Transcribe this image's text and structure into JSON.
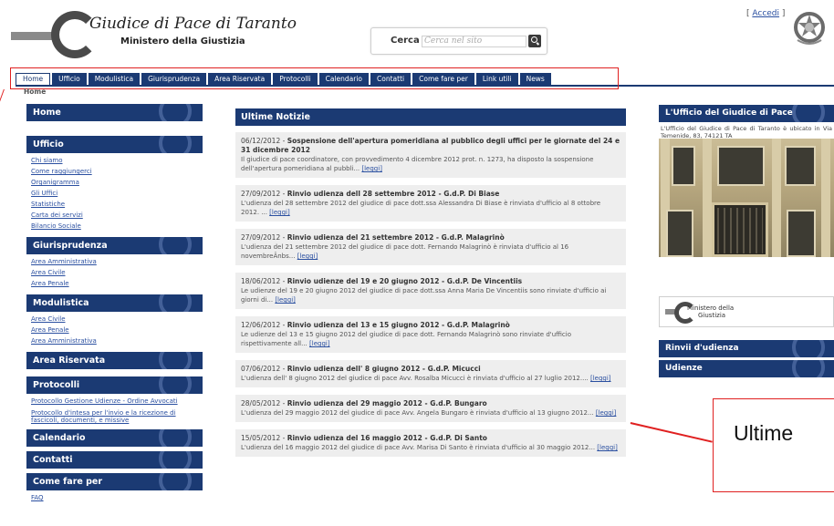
{
  "header": {
    "logo_title": "Giudice di Pace di Taranto",
    "logo_subtitle": "Ministero della Giustizia",
    "search_label": "Cerca",
    "search_placeholder": "Cerca nel sito",
    "login_open": "[ ",
    "login_label": "Accedi",
    "login_close": " ]"
  },
  "nav": {
    "items": [
      "Home",
      "Ufficio",
      "Modulistica",
      "Giurisprudenza",
      "Area Riservata",
      "Protocolli",
      "Calendario",
      "Contatti",
      "Come fare per",
      "Link utili",
      "News"
    ],
    "active": "Home"
  },
  "breadcrumb": "Home",
  "left": {
    "home": "Home",
    "ufficio": {
      "title": "Ufficio",
      "links": [
        "Chi siamo",
        "Come raggiungerci",
        "Organigramma",
        "Gli Uffici",
        "Statistiche",
        "Carta dei servizi",
        "Bilancio Sociale"
      ]
    },
    "giurisprudenza": {
      "title": "Giurisprudenza",
      "links": [
        "Area Amministrativa",
        "Area Civile",
        "Area Penale"
      ]
    },
    "modulistica": {
      "title": "Modulistica",
      "links": [
        "Area Civile",
        "Area Penale",
        "Area Amministrativa"
      ]
    },
    "area_riservata": "Area Riservata",
    "protocolli": {
      "title": "Protocolli",
      "links": [
        "Protocollo Gestione Udienze - Ordine Avvocati",
        "Protocollo d'intesa per l'invio e la ricezione di fascicoli, documenti, e missive"
      ]
    },
    "calendario": "Calendario",
    "contatti": "Contatti",
    "come_fare_per": {
      "title": "Come fare per",
      "links": [
        "FAQ"
      ]
    }
  },
  "center": {
    "title": "Ultime Notizie",
    "news": [
      {
        "date": "06/12/2012 - ",
        "title": "Sospensione dell'apertura pomeridiana al pubblico degli uffici per le giornate del 24 e 31 dicembre 2012",
        "body": "Il giudice di pace coordinatore, con provvedimento 4 dicembre 2012 prot. n. 1273, ha disposto la sospensione dell'apertura pomeridiana al pubbli... ",
        "link": "[leggi]"
      },
      {
        "date": "27/09/2012 - ",
        "title": "Rinvio udienza dell 28 settembre 2012 - G.d.P. Di Biase",
        "body": "L'udienza del 28 settembre 2012 del giudice di pace dott.ssa Alessandra Di Biase è rinviata d'ufficio al 8 ottobre 2012. ... ",
        "link": "[leggi]"
      },
      {
        "date": "27/09/2012 - ",
        "title": "Rinvio udienza del 21 settembre 2012 - G.d.P. Malagrinò",
        "body": "L'udienza del 21 settembre 2012 del giudice di pace dott. Fernando Malagrinò è rinviata d'ufficio al 16 novembreÂnbs... ",
        "link": "[leggi]"
      },
      {
        "date": "18/06/2012 - ",
        "title": "Rinvio udienze del 19 e 20 giugno 2012 - G.d.P. De Vincentiis",
        "body": "Le udienze del 19 e 20 giugno 2012 del giudice di pace dott.ssa Anna Maria De Vincentiis sono rinviate d'ufficio ai giorni di... ",
        "link": "[leggi]"
      },
      {
        "date": "12/06/2012 - ",
        "title": "Rinvio udienza del 13 e 15 giugno 2012 - G.d.P. Malagrinò",
        "body": "Le udienze del 13 e 15 giugno 2012 del giudice di pace dott. Fernando Malagrinò sono rinviate d'ufficio rispettivamente all... ",
        "link": "[leggi]"
      },
      {
        "date": "07/06/2012 - ",
        "title": "Rinvio udienza dell' 8 giugno 2012 - G.d.P. Micucci",
        "body": "L'udienza dell' 8 giugno 2012 del giudice di pace Avv. Rosalba Micucci è rinviata d'ufficio al 27 luglio 2012.... ",
        "link": "[leggi]"
      },
      {
        "date": "28/05/2012 - ",
        "title": "Rinvio udienza del 29 maggio 2012 - G.d.P. Bungaro",
        "body": "L'udienza del 29 maggio 2012 del giudice di pace Avv. Angela Bungaro è rinviata d'ufficio al 13 giugno 2012... ",
        "link": "[leggi]"
      },
      {
        "date": "15/05/2012 - ",
        "title": "Rinvio udienza del 16 maggio 2012 - G.d.P. Di Santo",
        "body": "L'udienza del 16 maggio 2012 del giudice di pace Avv. Marisa Di Santo è rinviata d'ufficio al 30 maggio 2012... ",
        "link": "[leggi]"
      }
    ]
  },
  "right": {
    "office_title": "L'Ufficio del Giudice di Pace",
    "office_text": "L'Ufficio del Giudice di Pace di Taranto è ubicato in Via Temenide, 83, 74121 TA",
    "ministry_line1": "Ministero della",
    "ministry_line2": "Giustizia",
    "rinvii": "Rinvii d'udienza",
    "udienze": "Udienze"
  },
  "callout": {
    "text": "Ultime"
  },
  "colors": {
    "primary": "#1b3a73",
    "link": "#2a4fa0",
    "annotation": "#e02020",
    "news_bg": "#eeeeee"
  }
}
